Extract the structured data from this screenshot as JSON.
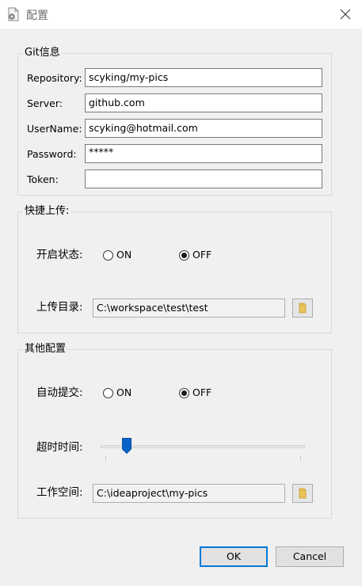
{
  "window": {
    "title": "配置"
  },
  "git": {
    "legend": "Git信息",
    "fields": [
      {
        "label": "Repository:",
        "value": "scyking/my-pics"
      },
      {
        "label": "Server:",
        "value": "github.com"
      },
      {
        "label": "UserName:",
        "value": "scyking@hotmail.com"
      },
      {
        "label": "Password:",
        "value": "*****"
      },
      {
        "label": "Token:",
        "value": ""
      }
    ]
  },
  "quick_upload": {
    "legend": "快捷上传:",
    "status_label": "开启状态:",
    "on_label": "ON",
    "off_label": "OFF",
    "selected": "OFF",
    "dir_label": "上传目录:",
    "dir_value": "C:\\workspace\\test\\test"
  },
  "other": {
    "legend": "其他配置",
    "auto_commit_label": "自动提交:",
    "on_label": "ON",
    "off_label": "OFF",
    "selected": "OFF",
    "timeout_label": "超时时间:",
    "timeout_level": 0.11,
    "workspace_label": "工作空间:",
    "workspace_value": "C:\\ideaproject\\my-pics"
  },
  "buttons": {
    "ok": "OK",
    "cancel": "Cancel"
  },
  "colors": {
    "accent": "#0078d7",
    "window_bg": "#f0f0f0",
    "titlebar_bg": "#ffffff",
    "folder": "#e9c35a",
    "slider_thumb": "#0a64c8"
  },
  "icons": {
    "app": "document-gear-icon",
    "close": "close-icon",
    "folder": "folder-icon"
  }
}
